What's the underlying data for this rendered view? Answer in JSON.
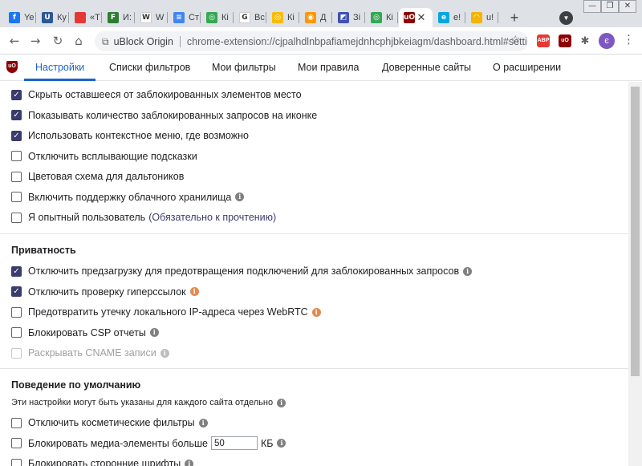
{
  "browser": {
    "tabs": [
      {
        "title": "Ye",
        "fav_color": "#1877f2",
        "fav_char": "f"
      },
      {
        "title": "Ку",
        "fav_color": "#2b5797",
        "fav_char": "U"
      },
      {
        "title": "«Т",
        "fav_color": "#e53935",
        "fav_char": ""
      },
      {
        "title": "И:",
        "fav_color": "#2e7d32",
        "fav_char": "F"
      },
      {
        "title": "W",
        "fav_color": "#ffffff",
        "fav_char": "W"
      },
      {
        "title": "Ст",
        "fav_color": "#4285f4",
        "fav_char": "≡"
      },
      {
        "title": "Кі",
        "fav_color": "#34a853",
        "fav_char": "◎"
      },
      {
        "title": "Вс",
        "fav_color": "#ffffff",
        "fav_char": "G"
      },
      {
        "title": "Кі",
        "fav_color": "#fbbc05",
        "fav_char": "◎"
      },
      {
        "title": "Д",
        "fav_color": "#ff9800",
        "fav_char": "◉"
      },
      {
        "title": "Зі",
        "fav_color": "#3f51b5",
        "fav_char": "◩"
      },
      {
        "title": "Кі",
        "fav_color": "#34a853",
        "fav_char": "◎"
      },
      {
        "title": "",
        "fav_color": "#8b0000",
        "fav_char": "uO",
        "active": true
      },
      {
        "title": "e!",
        "fav_color": "#00a8e1",
        "fav_char": "e"
      },
      {
        "title": "u!",
        "fav_color": "#f4b400",
        "fav_char": "◠"
      }
    ],
    "close_glyph": "✕",
    "newtab_glyph": "+",
    "tabsearch_glyph": "▼",
    "window_controls": {
      "minimize": "—",
      "restore": "❐",
      "close": "✕"
    },
    "nav": {
      "back": "←",
      "forward": "→",
      "reload": "↻",
      "home": "⌂"
    },
    "omnibox": {
      "ext_icon": "puzzle-icon",
      "site_name": "uBlock Origin",
      "url": "chrome-extension://cjpalhdlnbpafiamejdnhcphjbkeiagm/dashboard.html#setti..."
    },
    "star_glyph": "☆",
    "extensions": [
      {
        "label": "ABP",
        "color": "#e53935"
      },
      {
        "label": "uO",
        "color": "#8b0000"
      },
      {
        "label": "✱",
        "color": "#5f6368"
      }
    ],
    "avatar_letter": "є",
    "menu_glyph": "⋮"
  },
  "dashboard": {
    "logo_text": "uO",
    "tabs": [
      {
        "label": "Настройки",
        "active": true
      },
      {
        "label": "Списки фильтров"
      },
      {
        "label": "Мои фильтры"
      },
      {
        "label": "Мои правила"
      },
      {
        "label": "Доверенные сайты"
      },
      {
        "label": "О расширении"
      }
    ],
    "appearance": [
      {
        "label": "Скрыть оставшееся от заблокированных элементов место",
        "checked": true
      },
      {
        "label": "Показывать количество заблокированных запросов на иконке",
        "checked": true
      },
      {
        "label": "Использовать контекстное меню, где возможно",
        "checked": true
      },
      {
        "label": "Отключить всплывающие подсказки",
        "checked": false
      },
      {
        "label": "Цветовая схема для дальтоников",
        "checked": false
      },
      {
        "label": "Включить поддержку облачного хранилища",
        "checked": false,
        "info": "grey"
      },
      {
        "label": "Я опытный пользователь",
        "link": "(Обязательно к прочтению)",
        "checked": false
      }
    ],
    "privacy": {
      "heading": "Приватность",
      "items": [
        {
          "label": "Отключить предзагрузку для предотвращения подключений для заблокированных запросов",
          "checked": true,
          "info": "grey"
        },
        {
          "label": "Отключить проверку гиперссылок",
          "checked": true,
          "info": "orange"
        },
        {
          "label": "Предотвратить утечку локального IP-адреса через WebRTC",
          "checked": false,
          "info": "orange"
        },
        {
          "label": "Блокировать CSP отчеты",
          "checked": false,
          "info": "grey"
        },
        {
          "label": "Раскрывать CNAME записи",
          "checked": false,
          "info": "light",
          "disabled": true
        }
      ]
    },
    "defaults": {
      "heading": "Поведение по умолчанию",
      "note": "Эти настройки могут быть указаны для каждого сайта отдельно",
      "items": [
        {
          "label": "Отключить косметические фильтры",
          "checked": false,
          "info": "grey"
        },
        {
          "label": "Блокировать медиа-элементы больше",
          "checked": false,
          "input_value": "50",
          "unit": "КБ",
          "info": "grey"
        },
        {
          "label": "Блокировать сторонние шрифты",
          "checked": false,
          "info": "grey"
        }
      ]
    },
    "info_glyph": "i",
    "check_glyph": "✓"
  }
}
